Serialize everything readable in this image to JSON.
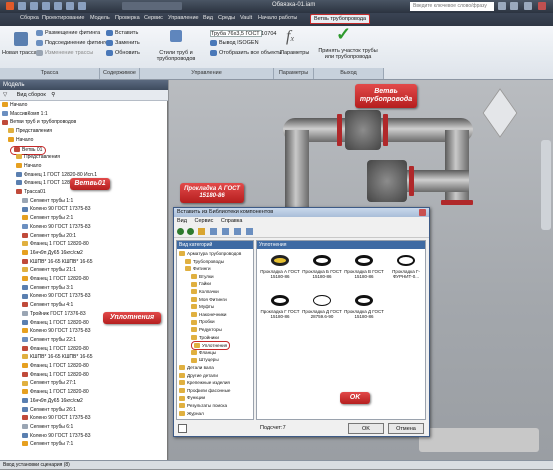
{
  "titlebar": {
    "doc_title": "Обвязка-01.iam",
    "search_placeholder": "Введите ключевое слово/фразу"
  },
  "tabs": [
    "Сборка",
    "Проектирование",
    "Модель",
    "Проверка",
    "Сервис",
    "Управление",
    "Вид",
    "Среды",
    "Vault",
    "Начало работы",
    "Ветвь трубопровода"
  ],
  "ribbon": {
    "place_fitting": "Размещение фитинга",
    "insert": "Вставить",
    "pipe_spec": "Труба 76x3,5 ГОСТ 10704",
    "new_route": "Новая трасса",
    "fitting_placement": "Подсоединение фитингов",
    "replace": "Заменить",
    "pipe_styles": "Стили труб и трубопроводов",
    "iso_output": "Вывод ISOGEN",
    "params": "Параметры",
    "accept": "Принять участок трубы или трубопровода",
    "edit_route": "Изменение трассы",
    "update": "Обновить",
    "show_objects": "Отобразить все объекты",
    "groups": [
      "Трасса",
      "Содержимое",
      "Управление",
      "Параметры",
      "Выход"
    ]
  },
  "leftpanel": {
    "title": "Модель",
    "view_label": "Вид сборок",
    "tree": [
      "Начало",
      "МассивКомп 1:1",
      "Ветви труб и трубопроводов",
      "Представления",
      "Начало",
      "Ветвь 01",
      "Представления",
      "Начало",
      "Фланец 1 ГОСТ 12820-80 Исп.1",
      "Фланец 1 ГОСТ 12820-80",
      "Трасса01",
      "Сегмент трубы 1:1",
      "Колено 90 ГОСТ 17375-83",
      "Сегмент трубы 2:1",
      "Колено 90 ГОСТ 17375-83",
      "Сегмент трубы 20:1",
      "Фланец 1 ГОСТ 12820-80",
      "16нч9п Ду65 16кгс/cм2",
      "КШПВ* 16-65 КШПВ* 16-65",
      "Сегмент трубы 21:1",
      "Фланец 1 ГОСТ 12820-80",
      "Сегмент трубы 3:1",
      "Колено 90 ГОСТ 17375-83",
      "Сегмент трубы 4:1",
      "Тройник ГОСТ 17376-83",
      "Фланец 1 ГОСТ 12820-80",
      "Колено 90 ГОСТ 17375-83",
      "Сегмент трубы 22:1",
      "Фланец 1 ГОСТ 12820-80",
      "КШПВ* 16-65 КШПВ* 16-65",
      "Фланец 1 ГОСТ 12820-80",
      "Фланец 1 ГОСТ 12820-80",
      "Сегмент трубы 27:1",
      "Фланец 1 ГОСТ 12820-80",
      "16нч9п Ду65 16кгс/cм2",
      "Сегмент трубы 26:1",
      "Колено 90 ГОСТ 17375-83",
      "Сегмент трубы 6:1",
      "Колено 90 ГОСТ 17375-83",
      "Сегмент трубы 7:1"
    ]
  },
  "dialog": {
    "title": "Вставить из Библиотеки компонентов",
    "menu": [
      "Вид",
      "Сервис",
      "Справка"
    ],
    "categories_header": "Вид категорий",
    "items_header": "Уплотнения",
    "categories": [
      "Арматура трубопроводов",
      "Трубопроводы",
      "Фитинги",
      "Втулки",
      "Гайки",
      "Колпачки",
      "Моя Фитинги",
      "Муфты",
      "Наконечники",
      "Пробки",
      "Редукторы",
      "Тройники",
      "Уплотнения",
      "Фланцы",
      "Штуцеры",
      "Детали вала",
      "Другие детали",
      "Крепежные изделия",
      "Профили фасонные",
      "Функции",
      "Результаты поиска",
      "Журнал"
    ],
    "items": [
      "Прокладка А ГОСТ 15180-86",
      "Прокладка Б ГОСТ 15180-86",
      "Прокладка В ГОСТ 15180-86",
      "Прокладка Г-ФУРНИТ-0...",
      "Прокладка Г ГОСТ 15180-86",
      "Прокладка Д ГОСТ 28759.6-90",
      "Прокладка Д ГОСТ 15180-86"
    ],
    "count": "Подсчет:7",
    "ok": "OK",
    "cancel": "Отмена"
  },
  "callouts": {
    "branch": "Ветвь трубопровода",
    "branch01": "Ветвь01",
    "gasket": "Прокладка А ГОСТ 15180-86",
    "seals": "Уплотнения",
    "ok": "OK"
  },
  "statusbar": {
    "text": "Ввод установки сценария (8)"
  },
  "colors": {
    "callout": "#c62a2a",
    "titlebar": "#2f3744",
    "accent": "#3e6aa3"
  }
}
